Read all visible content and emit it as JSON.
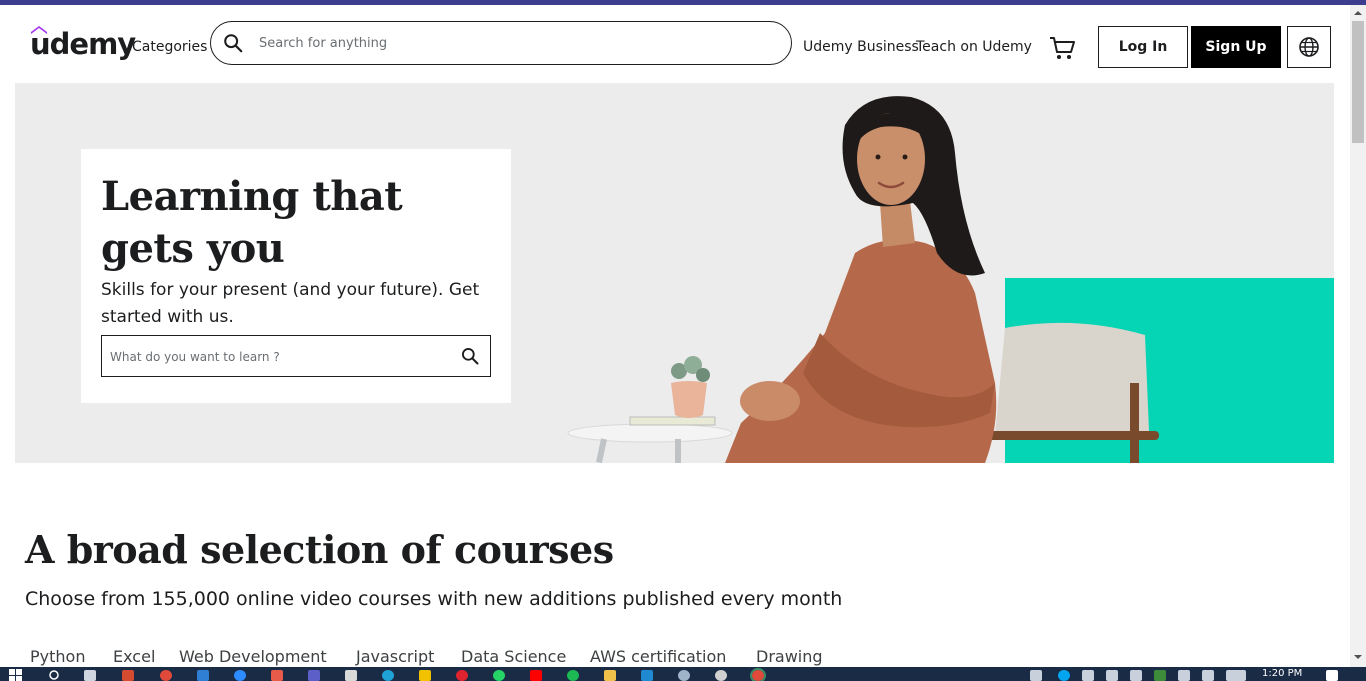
{
  "header": {
    "logo_text": "udemy",
    "categories_label": "Categories",
    "search_placeholder": "Search for anything",
    "business_link": "Udemy Business",
    "teach_link": "Teach on Udemy",
    "cart_icon": "cart-icon",
    "login_label": "Log In",
    "signup_label": "Sign Up",
    "language_icon": "globe-icon"
  },
  "hero": {
    "title": "Learning that gets you",
    "subtitle": "Skills for your present (and your future). Get started with us.",
    "search_placeholder": "What do you want to learn ?",
    "accent_color": "#05d5b4"
  },
  "courses": {
    "title": "A broad selection of courses",
    "subtitle": "Choose from 155,000 online video courses with new additions published every month",
    "topics": [
      "Python",
      "Excel",
      "Web Development",
      "Javascript",
      "Data Science",
      "AWS certification",
      "Drawing"
    ]
  },
  "taskbar": {
    "time": "1:20 PM"
  },
  "colors": {
    "brand_purple": "#a435f0",
    "text_dark": "#1c1d1f",
    "hero_bg": "#ececec",
    "taskbar": "#1a2b46"
  }
}
